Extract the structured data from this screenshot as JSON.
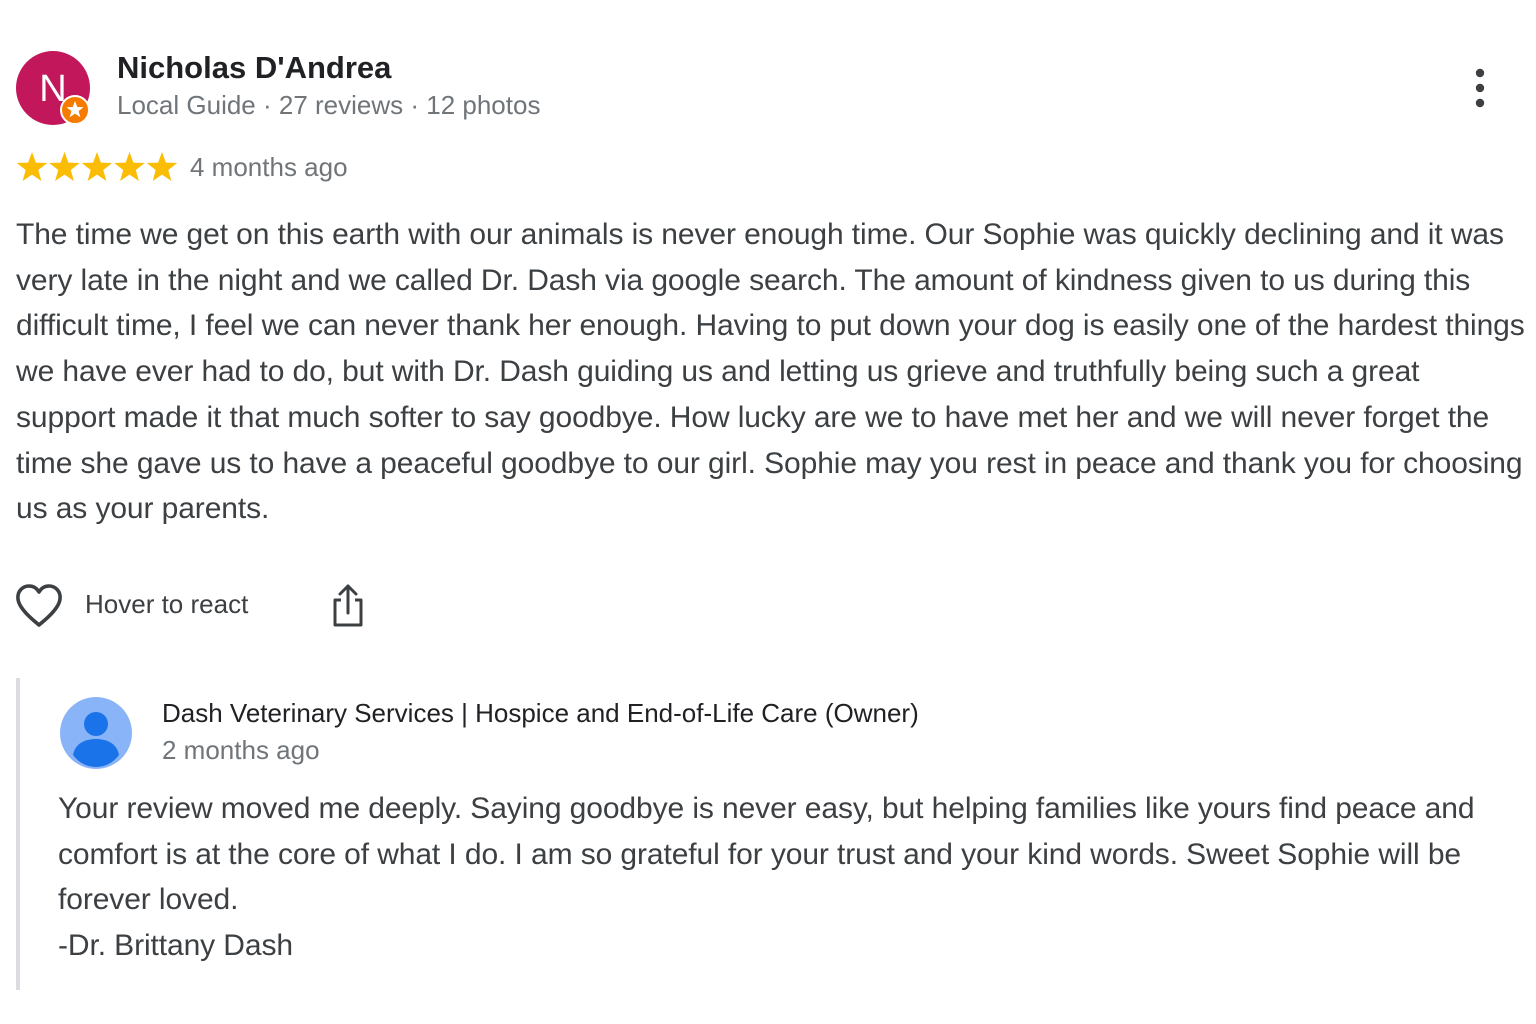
{
  "review": {
    "avatar_letter": "N",
    "avatar_color": "#c2185b",
    "badge_color": "#f57c00",
    "author_name": "Nicholas D'Andrea",
    "author_meta": "Local Guide · 27 reviews · 12 photos",
    "rating": 5,
    "rating_max": 5,
    "star_color": "#fbbc04",
    "date": "4 months ago",
    "text": "The time we get on this earth with our animals is never enough time. Our Sophie was quickly declining and it was very late in the night and we called Dr. Dash via google search. The amount of kindness given to us during this difficult time, I feel we can never thank her enough. Having to put down your dog is easily one of the hardest things we have ever had to do, but with Dr. Dash guiding us and letting us grieve and truthfully being such a great support made it that much softer to say goodbye. How lucky are we to have met her and we will never forget the time she gave us to have a peaceful goodbye to our girl. Sophie may you rest in peace and thank you for choosing us as your parents.",
    "more_icon": "more-vert-icon",
    "react_icon": "heart-outline-icon",
    "react_label": "Hover to react",
    "share_icon": "share-icon"
  },
  "reply": {
    "owner_avatar_icon": "person-icon",
    "owner_avatar_color": "#8ab4f8",
    "owner_name": "Dash Veterinary Services | Hospice and End-of-Life Care (Owner)",
    "date": "2 months ago",
    "text_main": "Your review moved me deeply. Saying goodbye is never easy, but helping families like yours find peace and comfort is at the core of what I do. I am so grateful for your trust and your kind words. Sweet Sophie will be forever loved.",
    "signature": "-Dr. Brittany Dash"
  }
}
